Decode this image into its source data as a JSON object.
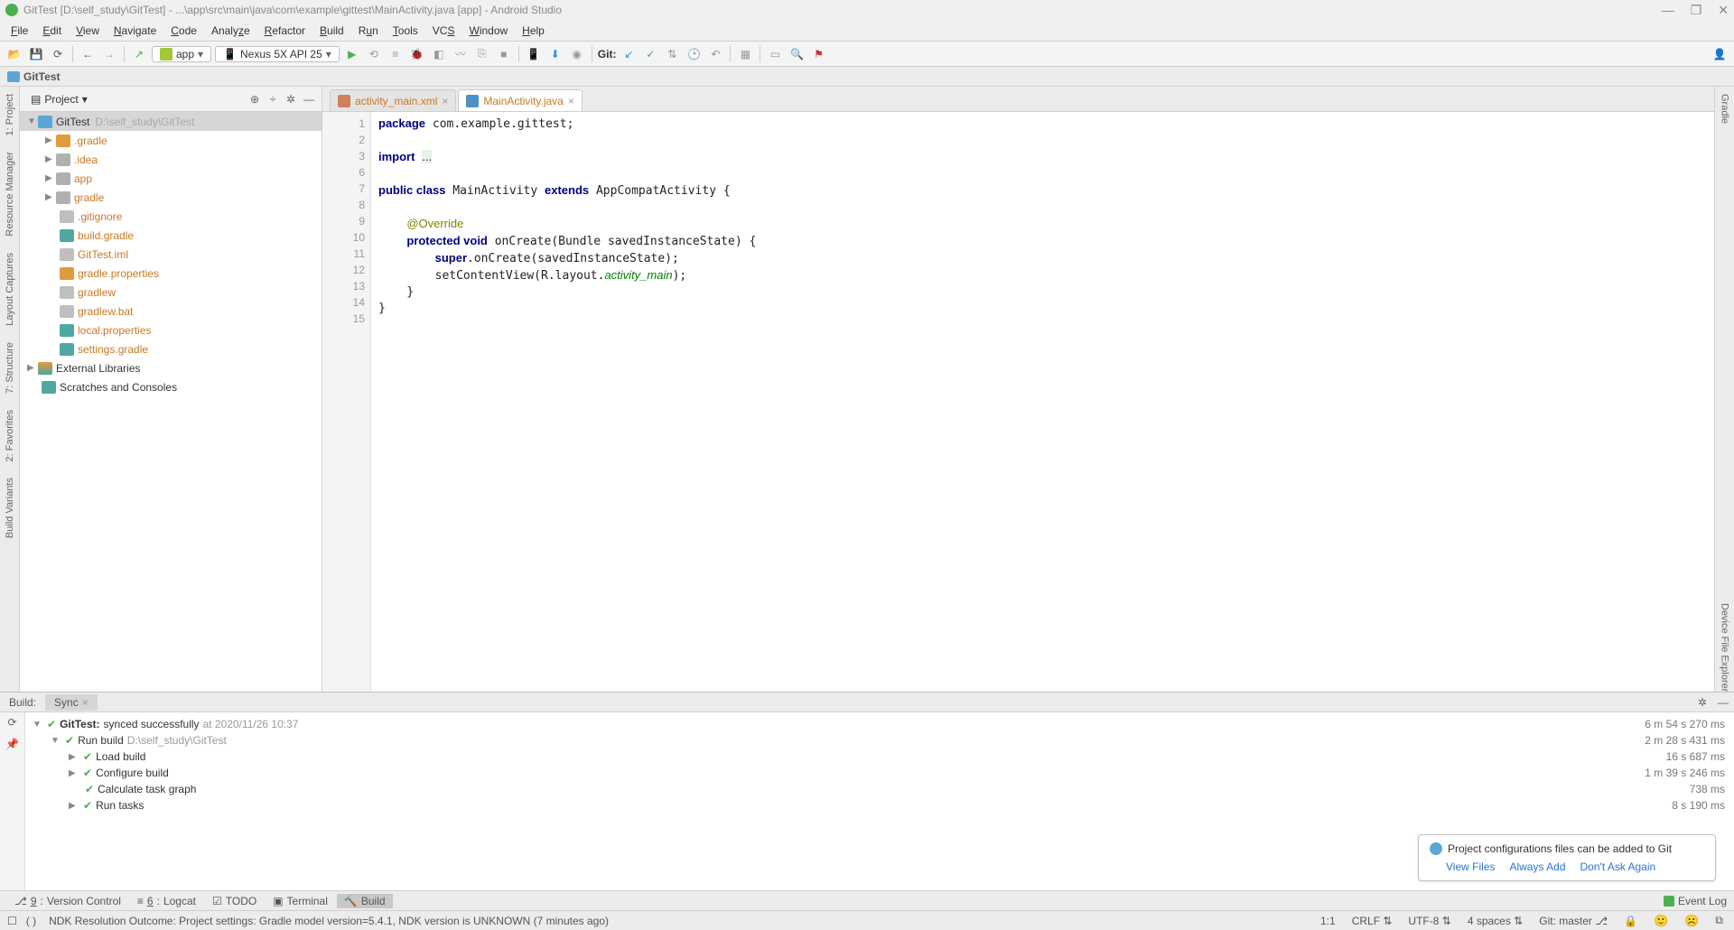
{
  "titlebar": {
    "title": "GitTest [D:\\self_study\\GitTest] - ...\\app\\src\\main\\java\\com\\example\\gittest\\MainActivity.java [app] - Android Studio"
  },
  "menu": [
    "File",
    "Edit",
    "View",
    "Navigate",
    "Code",
    "Analyze",
    "Refactor",
    "Build",
    "Run",
    "Tools",
    "VCS",
    "Window",
    "Help"
  ],
  "toolbar": {
    "run_config": "app",
    "device": "Nexus 5X API 25",
    "git_label": "Git:"
  },
  "breadcrumb": "GitTest",
  "left_gutter": [
    "1: Project",
    "Resource Manager",
    "Layout Captures",
    "7: Structure",
    "2: Favorites",
    "Build Variants"
  ],
  "right_gutter": [
    "Gradle",
    "Device File Explorer"
  ],
  "project_panel": {
    "scope": "Project"
  },
  "tree": {
    "root": {
      "name": "GitTest",
      "path": "D:\\self_study\\GitTest"
    },
    "items": [
      {
        "name": ".gradle",
        "type": "folder-orange"
      },
      {
        "name": ".idea",
        "type": "folder-gray"
      },
      {
        "name": "app",
        "type": "folder-gray"
      },
      {
        "name": "gradle",
        "type": "folder-gray"
      },
      {
        "name": ".gitignore",
        "type": "file-gray"
      },
      {
        "name": "build.gradle",
        "type": "file-teal"
      },
      {
        "name": "GitTest.iml",
        "type": "file-gray"
      },
      {
        "name": "gradle.properties",
        "type": "file-orange"
      },
      {
        "name": "gradlew",
        "type": "file-gray"
      },
      {
        "name": "gradlew.bat",
        "type": "file-gray"
      },
      {
        "name": "local.properties",
        "type": "file-teal"
      },
      {
        "name": "settings.gradle",
        "type": "file-teal"
      }
    ],
    "ext_lib": "External Libraries",
    "scratches": "Scratches and Consoles"
  },
  "tabs": [
    {
      "label": "activity_main.xml",
      "icon": "xml",
      "active": false
    },
    {
      "label": "MainActivity.java",
      "icon": "java",
      "active": true
    }
  ],
  "code": {
    "lines": [
      1,
      2,
      3,
      6,
      7,
      8,
      9,
      10,
      11,
      12,
      13,
      14,
      15
    ],
    "l1": "package com.example.gittest;",
    "l3a": "import ",
    "l3b": "...",
    "l7": "public class MainActivity extends AppCompatActivity {",
    "l9": "    @Override",
    "l10": "    protected void onCreate(Bundle savedInstanceState) {",
    "l11": "        super.onCreate(savedInstanceState);",
    "l12a": "        setContentView(R.layout.",
    "l12b": "activity_main",
    "l12c": ");",
    "l13": "    }",
    "l14": "}"
  },
  "build": {
    "tabs": [
      "Build:",
      "Sync"
    ],
    "root": {
      "name": "GitTest:",
      "status": "synced successfully",
      "ts": "at 2020/11/26 10:37"
    },
    "run_build": {
      "name": "Run build",
      "path": "D:\\self_study\\GitTest"
    },
    "steps": [
      "Load build",
      "Configure build",
      "Calculate task graph",
      "Run tasks"
    ],
    "times": [
      "6 m 54 s 270 ms",
      "2 m 28 s 431 ms",
      "16 s 687 ms",
      "1 m 39 s 246 ms",
      "738 ms",
      "8 s 190 ms"
    ]
  },
  "notice": {
    "msg": "Project configurations files can be added to Git",
    "links": [
      "View Files",
      "Always Add",
      "Don't Ask Again"
    ]
  },
  "toolstrip": {
    "items": [
      {
        "key": "9",
        "label": "Version Control"
      },
      {
        "key": "6",
        "label": "Logcat"
      },
      {
        "key": "",
        "label": "TODO"
      },
      {
        "key": "",
        "label": "Terminal"
      },
      {
        "key": "",
        "label": "Build",
        "active": true
      }
    ],
    "event_log": "Event Log"
  },
  "status": {
    "msg": "NDK Resolution Outcome: Project settings: Gradle model version=5.4.1, NDK version is UNKNOWN (7 minutes ago)",
    "pos": "1:1",
    "eol": "CRLF",
    "enc": "UTF-8",
    "indent": "4 spaces",
    "git": "Git: master"
  }
}
